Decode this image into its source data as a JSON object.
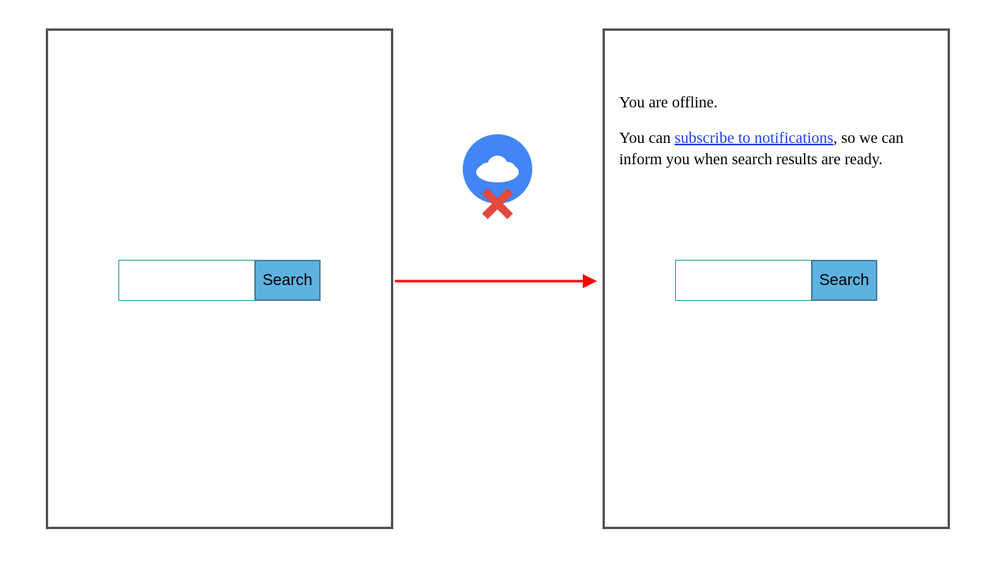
{
  "left": {
    "search_input_value": "",
    "search_button_label": "Search"
  },
  "right": {
    "offline_text": "You are offline.",
    "msg_prefix": "You can ",
    "link_text": "subscribe to notifications",
    "msg_suffix": ", so we can inform you when search results are ready.",
    "search_input_value": "",
    "search_button_label": "Search"
  },
  "icon": {
    "name": "cloud-offline",
    "circle_color": "#4285f4",
    "cloud_color": "#ffffff",
    "x_color": "#e5483d",
    "arrow_color": "#ff0000"
  }
}
